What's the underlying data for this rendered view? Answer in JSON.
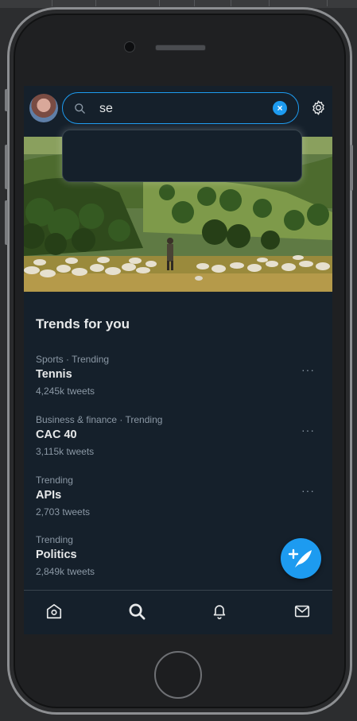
{
  "search": {
    "value": "se",
    "clear_symbol": "×",
    "icon": "search-icon"
  },
  "header": {
    "avatar": "profile-avatar",
    "settings_icon": "gear-icon"
  },
  "banner": {
    "image": "landscape-with-shepherd-and-sheep"
  },
  "trends": {
    "title": "Trends for you",
    "items": [
      {
        "context": "Sports · Trending",
        "name": "Tennis",
        "count": "4,245k tweets",
        "more": "···"
      },
      {
        "context": "Business & finance · Trending",
        "name": "CAC 40",
        "count": "3,115k tweets",
        "more": "···"
      },
      {
        "context": "Trending",
        "name": "APIs",
        "count": "2,703 tweets",
        "more": "···"
      },
      {
        "context": "Trending",
        "name": "Politics",
        "count": "2,849k tweets"
      }
    ]
  },
  "fab": {
    "icon": "compose-tweet-icon"
  },
  "nav": {
    "items": [
      "home-icon",
      "search-icon",
      "notifications-icon",
      "messages-icon"
    ],
    "active": "search-icon"
  },
  "colors": {
    "background": "#15202b",
    "accent": "#1d9bf0",
    "text_primary": "#e7e9ea",
    "text_secondary": "#8b98a5",
    "divider": "#38444d"
  }
}
